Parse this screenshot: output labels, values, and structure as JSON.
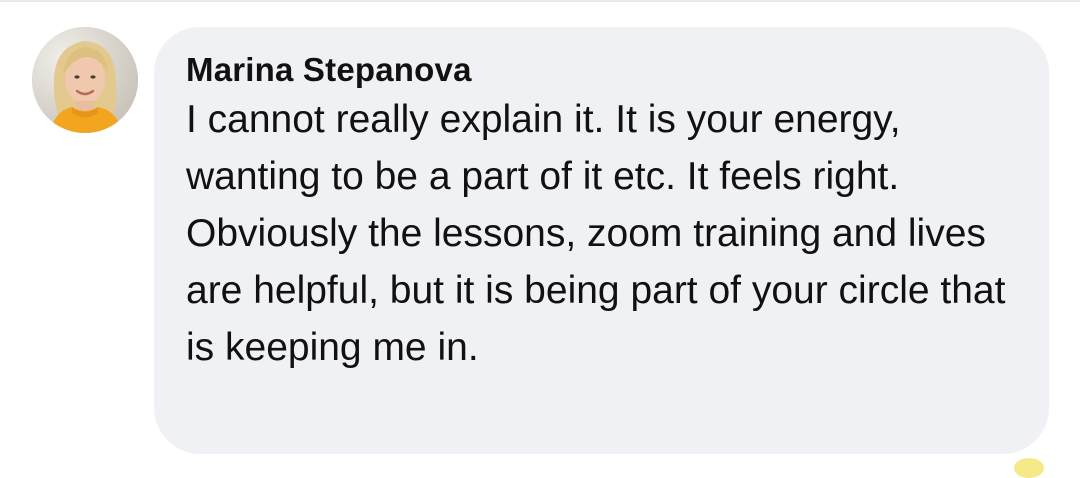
{
  "comment": {
    "author": "Marina Stepanova",
    "text": "I cannot really explain it. It is your energy, wanting to be a part of it etc. It feels right. Obviously the lessons, zoom training and lives are helpful, but it is being part of your circle that is keeping me in."
  },
  "colors": {
    "bubble_background": "#f0f1f5",
    "text": "#111111"
  }
}
